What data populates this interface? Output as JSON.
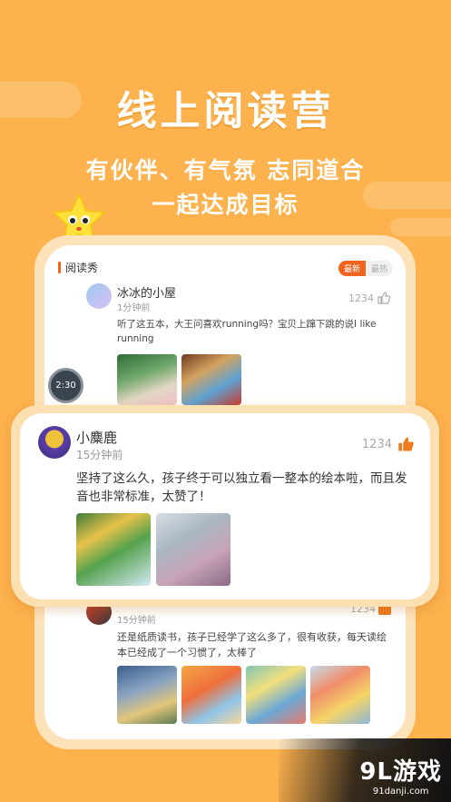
{
  "headline": "线上阅读营",
  "subline1": "有伙伴、有气氛 志同道合",
  "subline2": "一起达成目标",
  "section": {
    "title": "阅读秀",
    "tab_latest": "最新",
    "tab_hot": "最热"
  },
  "post1": {
    "username": "冰冰的小屋",
    "time": "1分钟前",
    "likes": "1234",
    "text": "听了这五本，大王问喜欢running吗？宝贝上蹿下跳的说I like running"
  },
  "timer": {
    "label": "2:30"
  },
  "featured": {
    "username": "小麋鹿",
    "time": "15分钟前",
    "likes": "1234",
    "text": "坚持了这么久，孩子终于可以独立看一整本的绘本啦，而且发音也非常标准，太赞了！"
  },
  "post3": {
    "time": "15分钟前",
    "likes": "1234",
    "text": "还是纸质读书，孩子已经学了这么多了，很有收获，每天读绘本已经成了一个习惯了，太棒了"
  },
  "watermark": {
    "logo": "9L游戏",
    "site": "91danji.com"
  },
  "colors": {
    "background": "#fdb24e",
    "accent": "#f0641e",
    "like_active": "#f07a1e"
  },
  "icons": [
    "thumbs-up-icon",
    "star-mascot-icon",
    "timer-icon"
  ]
}
